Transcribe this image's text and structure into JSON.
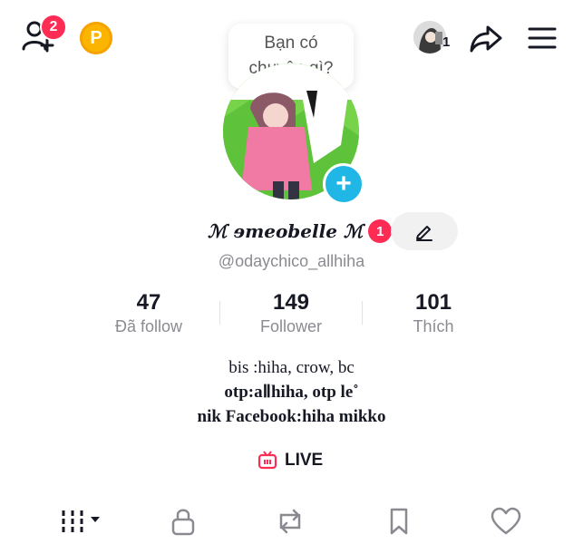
{
  "header": {
    "notification_count": "2",
    "coin_letter": "P",
    "post_prompt": "Bạn có chuyện gì?",
    "friends_count": "1"
  },
  "profile": {
    "display_name": "ℳ ɘmeobelle ℳ",
    "name_badge": "1",
    "username": "@odaychico_allhiha"
  },
  "stats": [
    {
      "value": "47",
      "label": "Đã follow"
    },
    {
      "value": "149",
      "label": "Follower"
    },
    {
      "value": "101",
      "label": "Thích"
    }
  ],
  "bio": {
    "line1": "bis :hiha, crow, bc",
    "line2": "otp:aⅡhiha, otp le˚",
    "line3": "nik Facebook:hiha mikko"
  },
  "live_label": "LIVE",
  "colors": {
    "accent_red": "#fe2c55",
    "coin": "#fbb400",
    "plus_blue": "#20b7e6"
  },
  "tabs": [
    "videos-grid-icon",
    "lock-icon",
    "repost-icon",
    "bookmark-icon",
    "heart-icon"
  ]
}
